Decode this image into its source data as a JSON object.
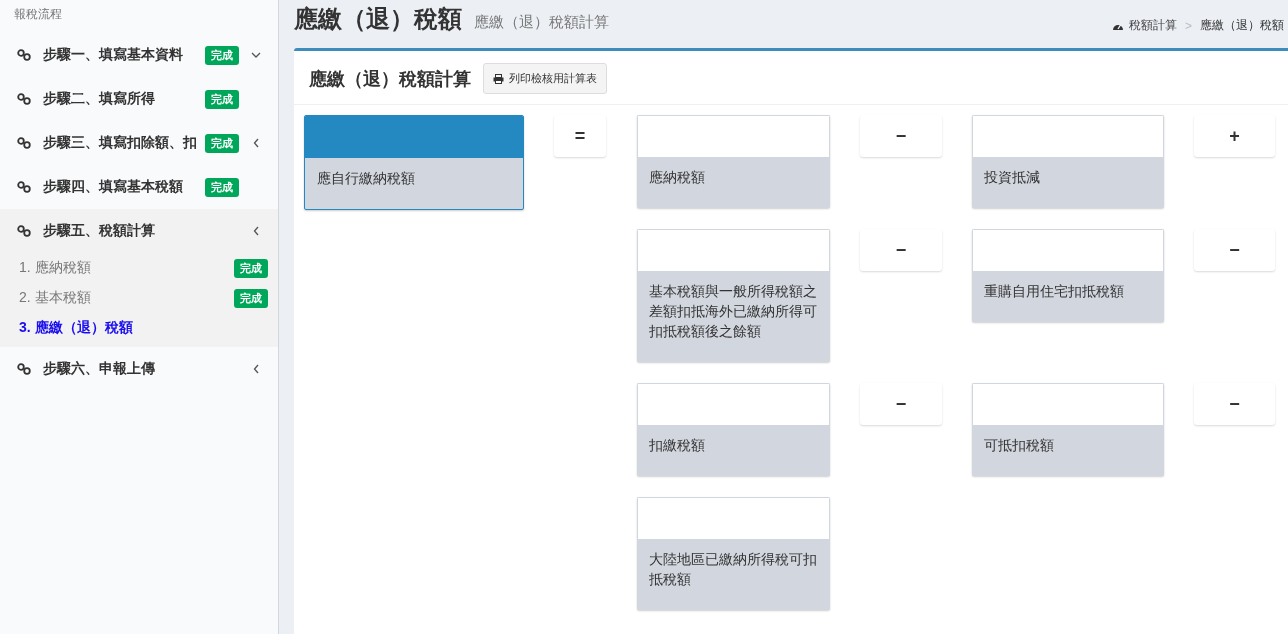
{
  "sidebar": {
    "title": "報稅流程",
    "steps": [
      {
        "label": "步驟一、填寫基本資料",
        "badge": "完成",
        "open": true,
        "selected": false
      },
      {
        "label": "步驟二、填寫所得",
        "badge": "完成",
        "selected": false
      },
      {
        "label": "步驟三、填寫扣除額、扣",
        "badge": "完成",
        "open": false,
        "selected": false
      },
      {
        "label": "步驟四、填寫基本稅額",
        "badge": "完成",
        "selected": false
      },
      {
        "label": "步驟五、稅額計算",
        "open": false,
        "selected": true,
        "children": [
          {
            "label": "1. 應納稅額",
            "badge": "完成",
            "selected": false
          },
          {
            "label": "2. 基本稅額",
            "badge": "完成",
            "selected": false
          },
          {
            "label": "3. 應繳（退）稅額",
            "selected": true
          }
        ]
      },
      {
        "label": "步驟六、申報上傳",
        "open": false,
        "selected": false
      }
    ]
  },
  "header": {
    "title": "應繳（退）稅額",
    "subtitle": "應繳（退）稅額計算",
    "breadcrumb": [
      "稅額計算",
      "應繳（退）稅額"
    ],
    "separator": ">"
  },
  "panel": {
    "title": "應繳（退）稅額計算",
    "print_button": "列印檢核用計算表",
    "result": {
      "label": "應自行繳納稅額"
    },
    "equals": "=",
    "terms": [
      [
        {
          "kind": "card",
          "label": "應納稅額"
        },
        {
          "kind": "operator",
          "symbol": "−"
        },
        {
          "kind": "card",
          "label": "投資抵減"
        },
        {
          "kind": "operator",
          "symbol": "+"
        }
      ],
      [
        {
          "kind": "card",
          "label": "基本稅額與一般所得稅額之差額扣抵海外已繳納所得可扣抵稅額後之餘額"
        },
        {
          "kind": "operator",
          "symbol": "−"
        },
        {
          "kind": "card",
          "label": "重購自用住宅扣抵稅額"
        },
        {
          "kind": "operator",
          "symbol": "−"
        }
      ],
      [
        {
          "kind": "card",
          "label": "扣繳稅額"
        },
        {
          "kind": "operator",
          "symbol": "−"
        },
        {
          "kind": "card",
          "label": "可抵扣稅額"
        },
        {
          "kind": "operator",
          "symbol": "−"
        }
      ],
      [
        {
          "kind": "card",
          "label": "大陸地區已繳納所得稅可扣抵稅額"
        }
      ]
    ]
  }
}
